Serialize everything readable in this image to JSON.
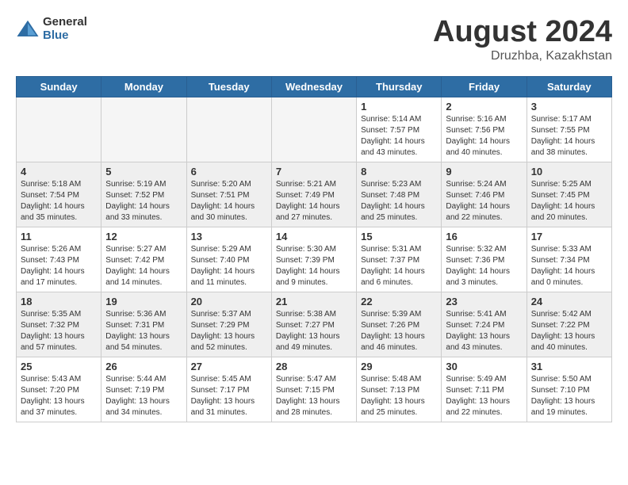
{
  "header": {
    "logo_general": "General",
    "logo_blue": "Blue",
    "month_title": "August 2024",
    "location": "Druzhba, Kazakhstan"
  },
  "weekdays": [
    "Sunday",
    "Monday",
    "Tuesday",
    "Wednesday",
    "Thursday",
    "Friday",
    "Saturday"
  ],
  "weeks": [
    [
      {
        "day": "",
        "info": ""
      },
      {
        "day": "",
        "info": ""
      },
      {
        "day": "",
        "info": ""
      },
      {
        "day": "",
        "info": ""
      },
      {
        "day": "1",
        "info": "Sunrise: 5:14 AM\nSunset: 7:57 PM\nDaylight: 14 hours and 43 minutes."
      },
      {
        "day": "2",
        "info": "Sunrise: 5:16 AM\nSunset: 7:56 PM\nDaylight: 14 hours and 40 minutes."
      },
      {
        "day": "3",
        "info": "Sunrise: 5:17 AM\nSunset: 7:55 PM\nDaylight: 14 hours and 38 minutes."
      }
    ],
    [
      {
        "day": "4",
        "info": "Sunrise: 5:18 AM\nSunset: 7:54 PM\nDaylight: 14 hours and 35 minutes."
      },
      {
        "day": "5",
        "info": "Sunrise: 5:19 AM\nSunset: 7:52 PM\nDaylight: 14 hours and 33 minutes."
      },
      {
        "day": "6",
        "info": "Sunrise: 5:20 AM\nSunset: 7:51 PM\nDaylight: 14 hours and 30 minutes."
      },
      {
        "day": "7",
        "info": "Sunrise: 5:21 AM\nSunset: 7:49 PM\nDaylight: 14 hours and 27 minutes."
      },
      {
        "day": "8",
        "info": "Sunrise: 5:23 AM\nSunset: 7:48 PM\nDaylight: 14 hours and 25 minutes."
      },
      {
        "day": "9",
        "info": "Sunrise: 5:24 AM\nSunset: 7:46 PM\nDaylight: 14 hours and 22 minutes."
      },
      {
        "day": "10",
        "info": "Sunrise: 5:25 AM\nSunset: 7:45 PM\nDaylight: 14 hours and 20 minutes."
      }
    ],
    [
      {
        "day": "11",
        "info": "Sunrise: 5:26 AM\nSunset: 7:43 PM\nDaylight: 14 hours and 17 minutes."
      },
      {
        "day": "12",
        "info": "Sunrise: 5:27 AM\nSunset: 7:42 PM\nDaylight: 14 hours and 14 minutes."
      },
      {
        "day": "13",
        "info": "Sunrise: 5:29 AM\nSunset: 7:40 PM\nDaylight: 14 hours and 11 minutes."
      },
      {
        "day": "14",
        "info": "Sunrise: 5:30 AM\nSunset: 7:39 PM\nDaylight: 14 hours and 9 minutes."
      },
      {
        "day": "15",
        "info": "Sunrise: 5:31 AM\nSunset: 7:37 PM\nDaylight: 14 hours and 6 minutes."
      },
      {
        "day": "16",
        "info": "Sunrise: 5:32 AM\nSunset: 7:36 PM\nDaylight: 14 hours and 3 minutes."
      },
      {
        "day": "17",
        "info": "Sunrise: 5:33 AM\nSunset: 7:34 PM\nDaylight: 14 hours and 0 minutes."
      }
    ],
    [
      {
        "day": "18",
        "info": "Sunrise: 5:35 AM\nSunset: 7:32 PM\nDaylight: 13 hours and 57 minutes."
      },
      {
        "day": "19",
        "info": "Sunrise: 5:36 AM\nSunset: 7:31 PM\nDaylight: 13 hours and 54 minutes."
      },
      {
        "day": "20",
        "info": "Sunrise: 5:37 AM\nSunset: 7:29 PM\nDaylight: 13 hours and 52 minutes."
      },
      {
        "day": "21",
        "info": "Sunrise: 5:38 AM\nSunset: 7:27 PM\nDaylight: 13 hours and 49 minutes."
      },
      {
        "day": "22",
        "info": "Sunrise: 5:39 AM\nSunset: 7:26 PM\nDaylight: 13 hours and 46 minutes."
      },
      {
        "day": "23",
        "info": "Sunrise: 5:41 AM\nSunset: 7:24 PM\nDaylight: 13 hours and 43 minutes."
      },
      {
        "day": "24",
        "info": "Sunrise: 5:42 AM\nSunset: 7:22 PM\nDaylight: 13 hours and 40 minutes."
      }
    ],
    [
      {
        "day": "25",
        "info": "Sunrise: 5:43 AM\nSunset: 7:20 PM\nDaylight: 13 hours and 37 minutes."
      },
      {
        "day": "26",
        "info": "Sunrise: 5:44 AM\nSunset: 7:19 PM\nDaylight: 13 hours and 34 minutes."
      },
      {
        "day": "27",
        "info": "Sunrise: 5:45 AM\nSunset: 7:17 PM\nDaylight: 13 hours and 31 minutes."
      },
      {
        "day": "28",
        "info": "Sunrise: 5:47 AM\nSunset: 7:15 PM\nDaylight: 13 hours and 28 minutes."
      },
      {
        "day": "29",
        "info": "Sunrise: 5:48 AM\nSunset: 7:13 PM\nDaylight: 13 hours and 25 minutes."
      },
      {
        "day": "30",
        "info": "Sunrise: 5:49 AM\nSunset: 7:11 PM\nDaylight: 13 hours and 22 minutes."
      },
      {
        "day": "31",
        "info": "Sunrise: 5:50 AM\nSunset: 7:10 PM\nDaylight: 13 hours and 19 minutes."
      }
    ]
  ]
}
